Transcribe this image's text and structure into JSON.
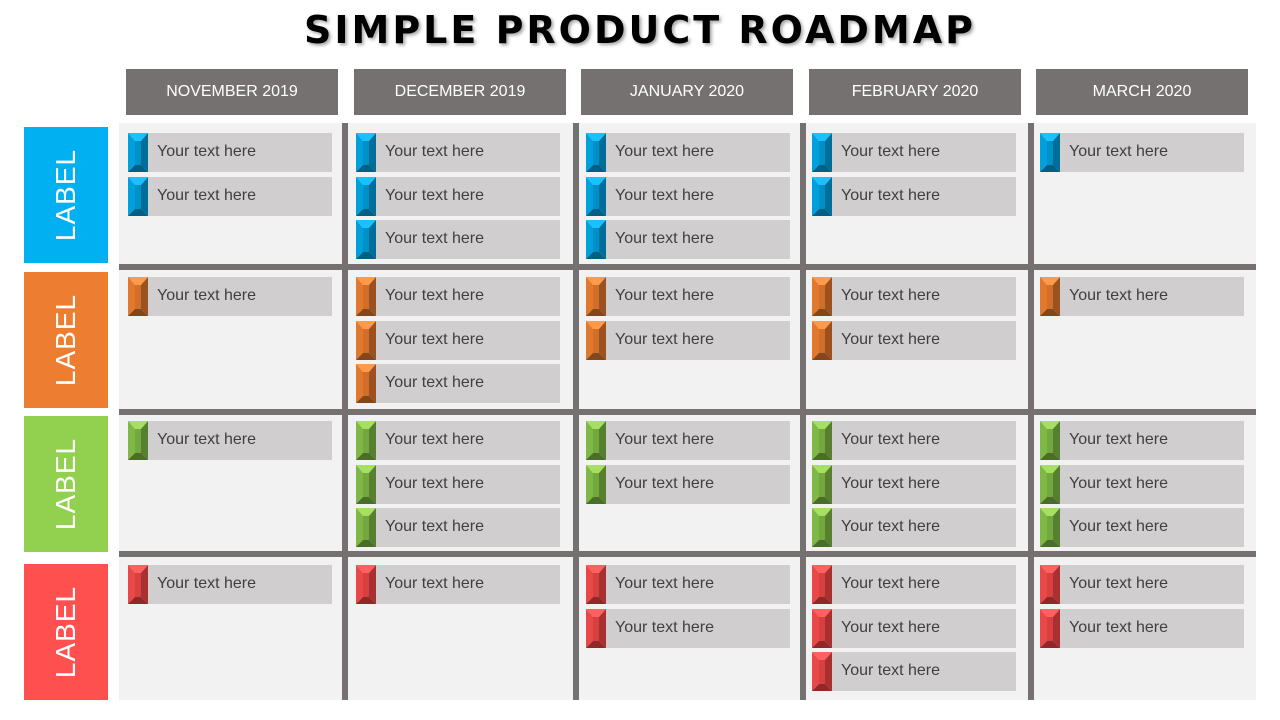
{
  "title": "SIMPLE PRODUCT ROADMAP",
  "months": [
    "NOVEMBER 2019",
    "DECEMBER 2019",
    "JANUARY 2020",
    "FEBRUARY 2020",
    "MARCH 2020"
  ],
  "rows": [
    {
      "label": "LABEL",
      "color": "#00b0f0",
      "marker": {
        "top": "#19c2ff",
        "left": "#00a0dc",
        "mid": "#0090c8",
        "right": "#006e99",
        "bottom": "#005f85"
      },
      "cells": [
        [
          "Your text here",
          "Your text here"
        ],
        [
          "Your text here",
          "Your text here",
          "Your text here"
        ],
        [
          "Your text here",
          "Your text here",
          "Your text here"
        ],
        [
          "Your text here",
          "Your text here"
        ],
        [
          "Your text here"
        ]
      ]
    },
    {
      "label": "LABEL",
      "color": "#ed7d31",
      "marker": {
        "top": "#ff9a4a",
        "left": "#e0782e",
        "mid": "#d06e2a",
        "right": "#9c5220",
        "bottom": "#84461b"
      },
      "cells": [
        [
          "Your text here"
        ],
        [
          "Your text here",
          "Your text here",
          "Your text here"
        ],
        [
          "Your text here",
          "Your text here"
        ],
        [
          "Your text here",
          "Your text here"
        ],
        [
          "Your text here"
        ]
      ]
    },
    {
      "label": "LABEL",
      "color": "#92d050",
      "marker": {
        "top": "#a6e060",
        "left": "#80b848",
        "mid": "#72a83e",
        "right": "#568030",
        "bottom": "#4a6e28"
      },
      "cells": [
        [
          "Your text here"
        ],
        [
          "Your text here",
          "Your text here",
          "Your text here"
        ],
        [
          "Your text here",
          "Your text here"
        ],
        [
          "Your text here",
          "Your text here",
          "Your text here"
        ],
        [
          "Your text here",
          "Your text here",
          "Your text here"
        ]
      ]
    },
    {
      "label": "LABEL",
      "color": "#ff5050",
      "marker": {
        "top": "#ff6060",
        "left": "#e84848",
        "mid": "#d84040",
        "right": "#a83030",
        "bottom": "#902828"
      },
      "cells": [
        [
          "Your text here"
        ],
        [
          "Your text here"
        ],
        [
          "Your text here",
          "Your text here"
        ],
        [
          "Your text here",
          "Your text here",
          "Your text here"
        ],
        [
          "Your text here",
          "Your text here"
        ]
      ]
    }
  ]
}
